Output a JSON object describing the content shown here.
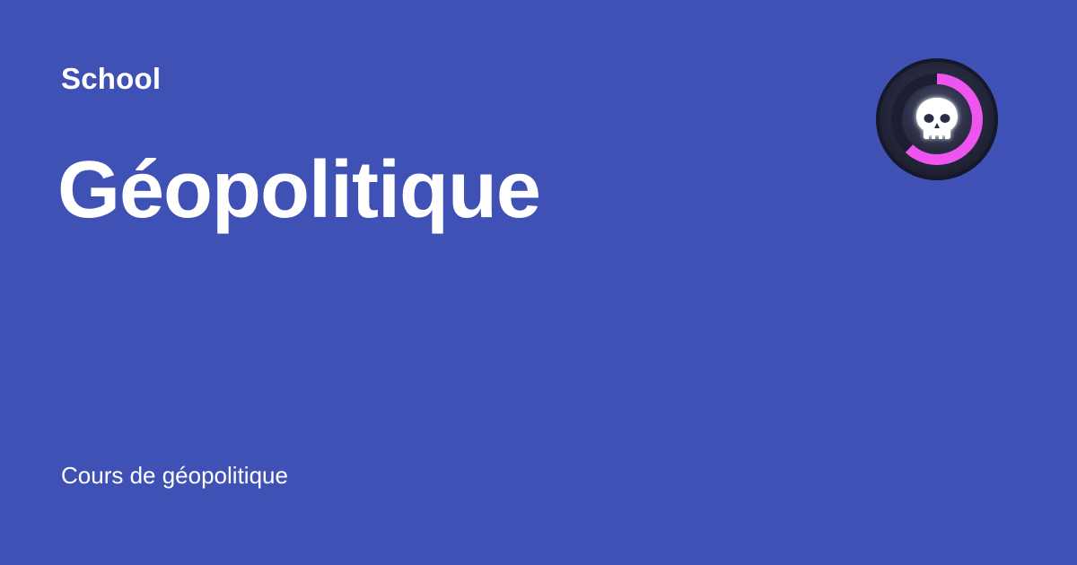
{
  "header": {
    "eyebrow": "School"
  },
  "main": {
    "title": "Géopolitique",
    "subtitle": "Cours de géopolitique"
  },
  "badge": {
    "icon": "skull-icon",
    "progress_fraction": 0.62,
    "ring_color": "#ee55ee",
    "track_color": "#1c1f33"
  },
  "colors": {
    "background": "#3f51b5",
    "text": "#ffffff"
  }
}
